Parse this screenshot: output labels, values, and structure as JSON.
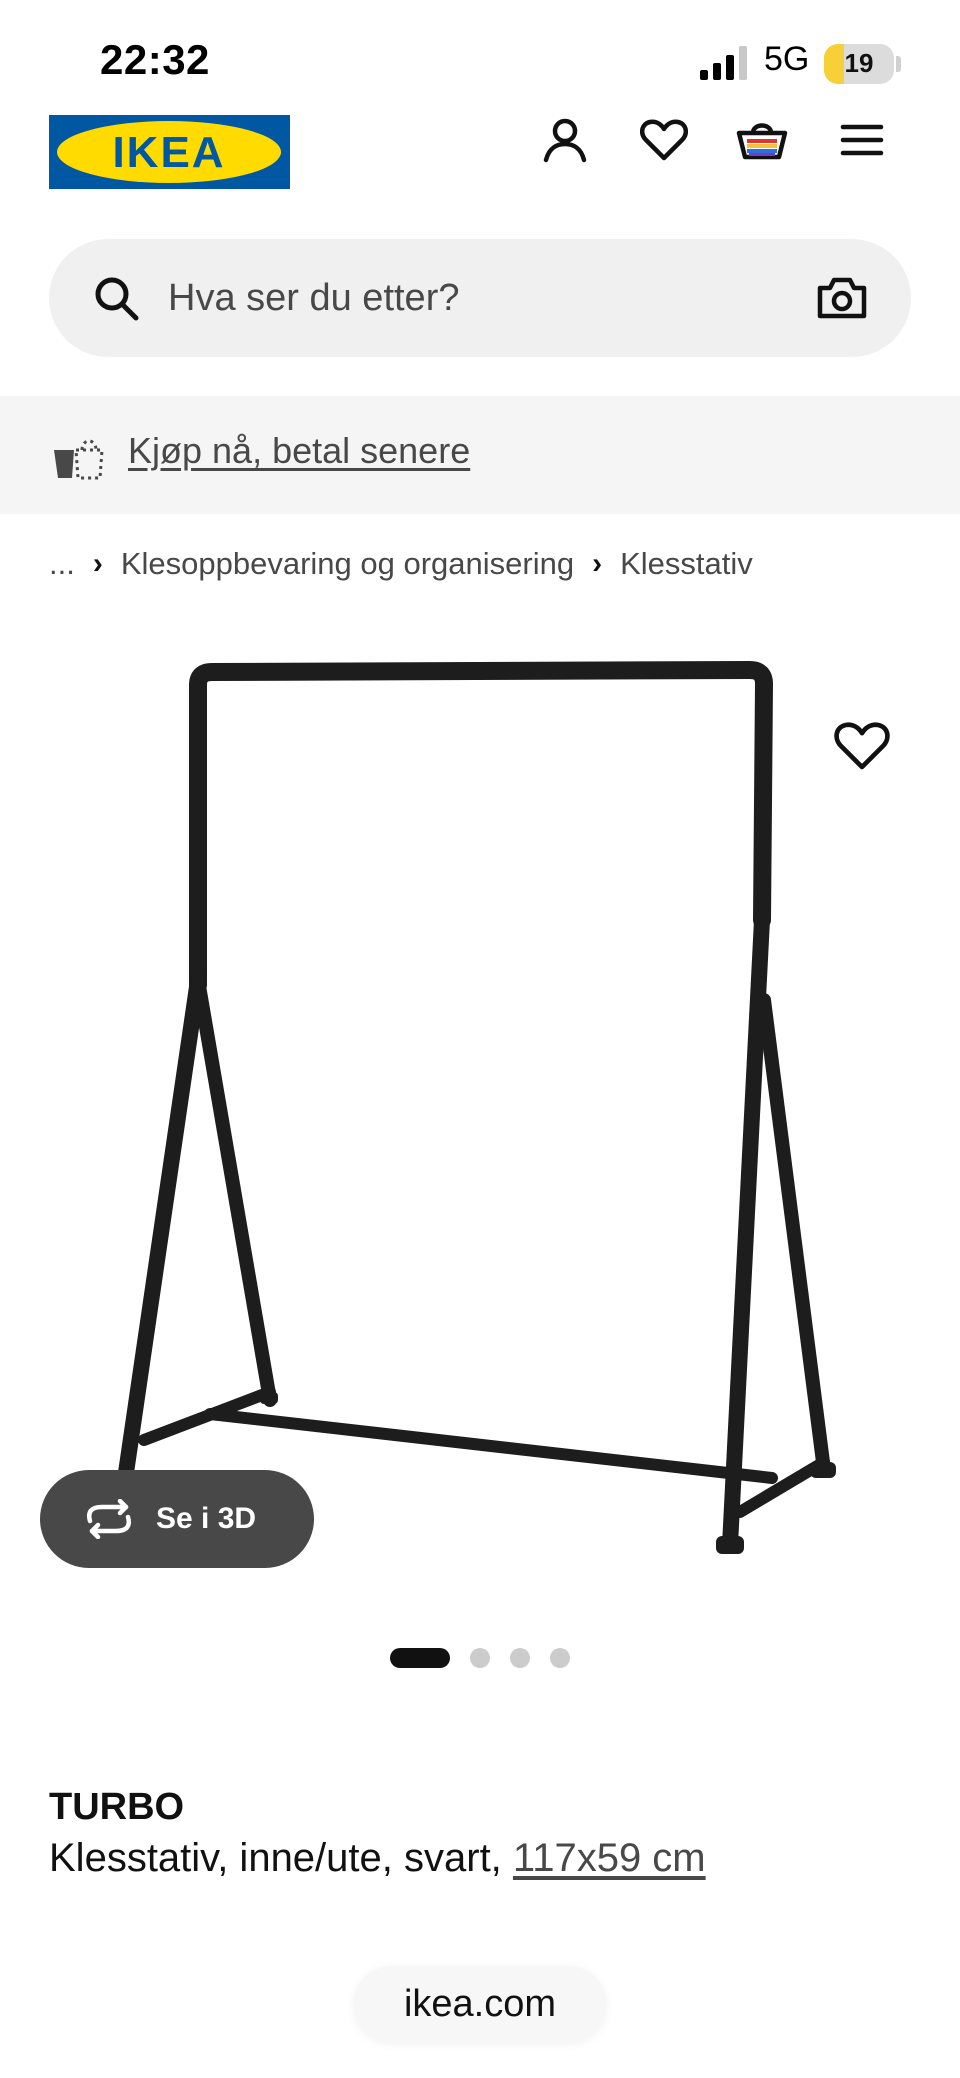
{
  "status_bar": {
    "time": "22:32",
    "network": "5G",
    "battery": "19"
  },
  "header": {
    "logo_text": "IKEA",
    "icons": [
      "account-icon",
      "heart-icon",
      "cart-icon",
      "menu-icon"
    ]
  },
  "search": {
    "placeholder": "Hva ser du etter?"
  },
  "banner": {
    "label": "Kjøp nå, betal senere"
  },
  "breadcrumb": {
    "ellipsis": "...",
    "items": [
      "Klesoppbevaring og organisering",
      "Klesstativ"
    ]
  },
  "media": {
    "view_3d_label": "Se i 3D",
    "image_count": 4,
    "active_index": 0
  },
  "product": {
    "name": "TURBO",
    "description": "Klesstativ, inne/ute, svart,",
    "size": "117x59 cm"
  },
  "browser": {
    "url": "ikea.com"
  },
  "colors": {
    "ikea_blue": "#0058a3",
    "ikea_yellow": "#ffdb00",
    "text_dark": "#111111",
    "text_muted": "#484848"
  }
}
